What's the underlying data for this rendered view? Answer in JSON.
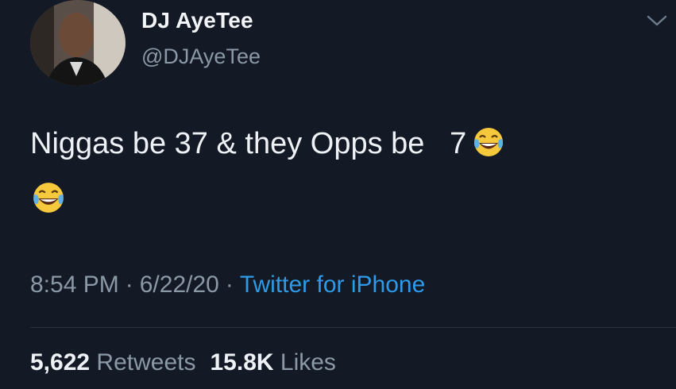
{
  "user": {
    "display_name": "DJ AyeTee",
    "handle": "@DJAyeTee"
  },
  "tweet": {
    "text_line1": "Niggas be 37 & they Opps be   7",
    "emoji_name": "face-with-tears-of-joy-icon"
  },
  "meta": {
    "time": "8:54 PM",
    "separator": "·",
    "date": "6/22/20",
    "source": "Twitter for iPhone"
  },
  "stats": {
    "retweets_count": "5,622",
    "retweets_label": "Retweets",
    "likes_count": "15.8K",
    "likes_label": "Likes"
  },
  "colors": {
    "background": "#141926",
    "link": "#2d9be8",
    "secondary_text": "#8b98a6",
    "primary_text": "#eef1f5"
  }
}
